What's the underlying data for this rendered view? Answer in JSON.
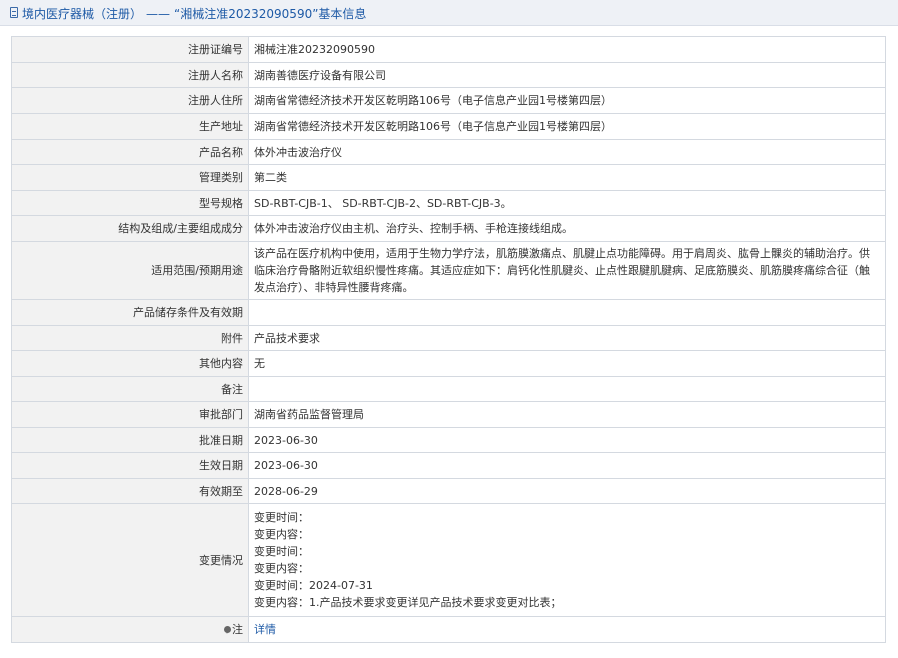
{
  "header": {
    "crumb": "境内医疗器械（注册）",
    "separator": "——",
    "title": "“湘械注准20232090590”基本信息"
  },
  "rows": [
    {
      "label": "注册证编号",
      "value": "湘械注准20232090590"
    },
    {
      "label": "注册人名称",
      "value": "湖南善德医疗设备有限公司"
    },
    {
      "label": "注册人住所",
      "value": "湖南省常德经济技术开发区乾明路106号（电子信息产业园1号楼第四层）"
    },
    {
      "label": "生产地址",
      "value": "湖南省常德经济技术开发区乾明路106号（电子信息产业园1号楼第四层）"
    },
    {
      "label": "产品名称",
      "value": "体外冲击波治疗仪"
    },
    {
      "label": "管理类别",
      "value": "第二类"
    },
    {
      "label": "型号规格",
      "value": "SD-RBT-CJB-1、 SD-RBT-CJB-2、SD-RBT-CJB-3。"
    },
    {
      "label": "结构及组成/主要组成成分",
      "value": "体外冲击波治疗仪由主机、治疗头、控制手柄、手枪连接线组成。"
    },
    {
      "label": "适用范围/预期用途",
      "value": "该产品在医疗机构中使用，适用于生物力学疗法，肌筋膜激痛点、肌腱止点功能障碍。用于肩周炎、肱骨上髁炎的辅助治疗。供临床治疗骨骼附近软组织慢性疼痛。其适应症如下：肩钙化性肌腱炎、止点性跟腱肌腱病、足底筋膜炎、肌筋膜疼痛综合征（触发点治疗）、非特异性腰背疼痛。"
    },
    {
      "label": "产品储存条件及有效期",
      "value": ""
    },
    {
      "label": "附件",
      "value": "产品技术要求"
    },
    {
      "label": "其他内容",
      "value": "无"
    },
    {
      "label": "备注",
      "value": ""
    },
    {
      "label": "审批部门",
      "value": "湖南省药品监督管理局"
    },
    {
      "label": "批准日期",
      "value": "2023-06-30"
    },
    {
      "label": "生效日期",
      "value": "2023-06-30"
    },
    {
      "label": "有效期至",
      "value": "2028-06-29"
    }
  ],
  "changes": {
    "label": "变更情况",
    "lines": [
      "变更时间：",
      "变更内容：",
      "变更时间：",
      "变更内容：",
      "变更时间：2024-07-31",
      "变更内容：1.产品技术要求变更详见产品技术要求变更对比表；"
    ]
  },
  "note": {
    "label": "注",
    "icon": "pin-icon",
    "link_text": "详情"
  },
  "colors": {
    "header_bg": "#eef1f6",
    "link": "#1e5aa6",
    "label_bg": "#f2f2f2",
    "border": "#d4d9e0"
  }
}
